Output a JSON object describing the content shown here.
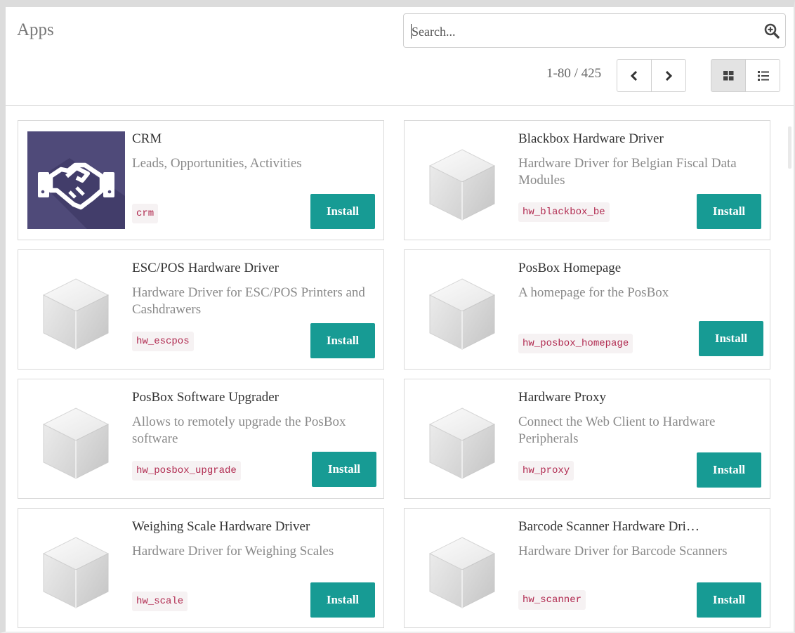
{
  "header": {
    "breadcrumb": "Apps",
    "search_placeholder": "Search...",
    "pager_value": "1-80 / 425"
  },
  "colors": {
    "install_button": "#179b94",
    "tech_name_text": "#b0294f",
    "crm_icon_bg": "#4f4a79"
  },
  "apps": [
    {
      "title": "CRM",
      "summary": "Leads, Opportunities, Activities",
      "technical_name": "crm",
      "button": "Install",
      "icon": "crm-handshake-icon"
    },
    {
      "title": "Blackbox Hardware Driver",
      "summary": "Hardware Driver for Belgian Fiscal Data Modules",
      "technical_name": "hw_blackbox_be",
      "button": "Install",
      "icon": "module-cube-icon"
    },
    {
      "title": "ESC/POS Hardware Driver",
      "summary": "Hardware Driver for ESC/POS Printers and Cashdrawers",
      "technical_name": "hw_escpos",
      "button": "Install",
      "icon": "module-cube-icon"
    },
    {
      "title": "PosBox Homepage",
      "summary": "A homepage for the PosBox",
      "technical_name": "hw_posbox_homepage",
      "button": "Install",
      "icon": "module-cube-icon"
    },
    {
      "title": "PosBox Software Upgrader",
      "summary": "Allows to remotely upgrade the PosBox software",
      "technical_name": "hw_posbox_upgrade",
      "button": "Install",
      "icon": "module-cube-icon"
    },
    {
      "title": "Hardware Proxy",
      "summary": "Connect the Web Client to Hardware Peripherals",
      "technical_name": "hw_proxy",
      "button": "Install",
      "icon": "module-cube-icon"
    },
    {
      "title": "Weighing Scale Hardware Driver",
      "summary": "Hardware Driver for Weighing Scales",
      "technical_name": "hw_scale",
      "button": "Install",
      "icon": "module-cube-icon"
    },
    {
      "title": "Barcode Scanner Hardware Dri…",
      "summary": "Hardware Driver for Barcode Scanners",
      "technical_name": "hw_scanner",
      "button": "Install",
      "icon": "module-cube-icon"
    }
  ]
}
